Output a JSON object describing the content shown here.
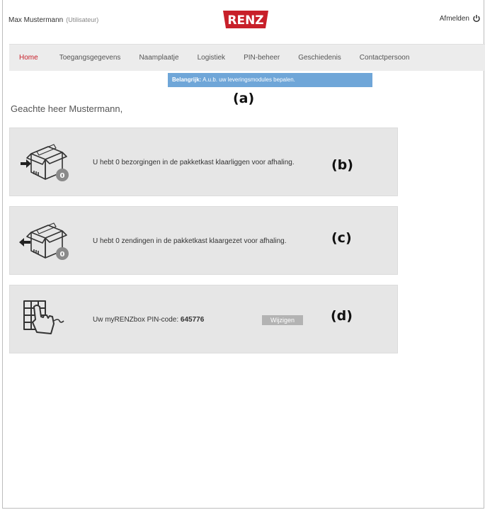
{
  "header": {
    "user_name": "Max Mustermann",
    "user_role": "(Utilisateur)",
    "logo_text": "RENZ",
    "logout_label": "Afmelden"
  },
  "nav": {
    "tabs": [
      {
        "label": "Home"
      },
      {
        "label": "Toegangsgegevens"
      },
      {
        "label": "Naamplaatje"
      },
      {
        "label": "Logistiek"
      },
      {
        "label": "PIN-beheer"
      },
      {
        "label": "Geschiedenis"
      },
      {
        "label": "Contactpersoon"
      }
    ],
    "active_tab": "Home"
  },
  "notice": {
    "strong": "Belangrijk:",
    "text": " A.u.b. uw leveringsmodules bepalen."
  },
  "annotations": {
    "a": "(a)",
    "b": "(b)",
    "c": "(c)",
    "d": "(d)"
  },
  "greeting": "Geachte heer Mustermann,",
  "cards": {
    "pickups": {
      "text": "U hebt 0 bezorgingen in de pakketkast klaarliggen voor afhaling.",
      "count": "0",
      "icon": "box-incoming-icon"
    },
    "shipments": {
      "text": "U hebt 0 zendingen in de pakketkast klaargezet voor afhaling.",
      "count": "0",
      "icon": "box-outgoing-icon"
    },
    "pin": {
      "label": "Uw myRENZbox PIN-code: ",
      "code": "645776",
      "button": "Wijzigen",
      "icon": "keypad-hand-icon"
    }
  },
  "colors": {
    "brand_red": "#c8202a",
    "notice_blue": "#6fa6d8",
    "card_bg": "#e6e6e6",
    "nav_bg": "#ececec"
  }
}
